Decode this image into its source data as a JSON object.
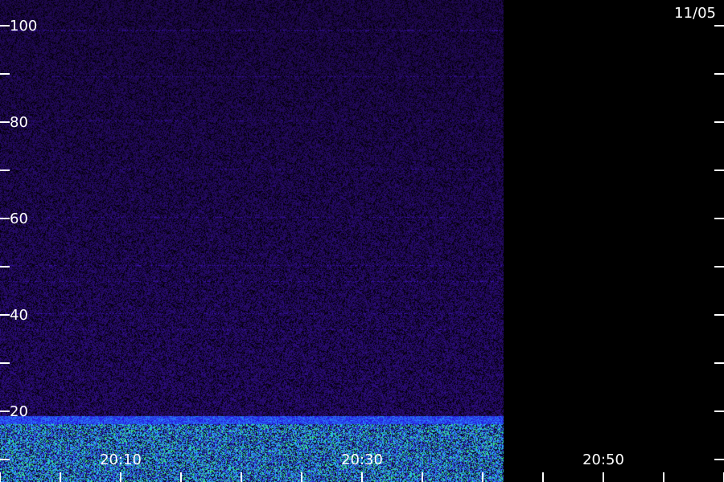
{
  "chart_data": {
    "type": "heatmap",
    "title": "",
    "xlabel": "",
    "ylabel": "",
    "date_label": "11/05",
    "x_tick_labels": [
      "20:10",
      "20:30",
      "20:50"
    ],
    "y_tick_labels": [
      "20",
      "40",
      "60",
      "80",
      "100"
    ],
    "ylim": [
      0,
      105
    ],
    "data_end_time": "20:42",
    "colors": {
      "background": "#000000",
      "low": "#1a0a4a",
      "mid": "#3d1fd6",
      "high": "#2ea8ff",
      "peak": "#3cff7a",
      "axis": "#ffffff"
    }
  }
}
